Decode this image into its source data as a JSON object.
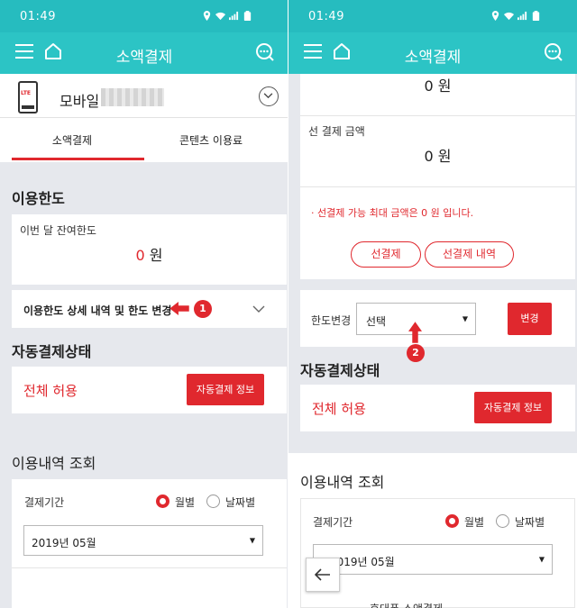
{
  "status": {
    "time": "01:49"
  },
  "app": {
    "title": "소액결제"
  },
  "left": {
    "device_label": "모바일",
    "lte_label": "LTE",
    "tabs": [
      "소액결제",
      "콘텐츠 이용료"
    ],
    "usage_limit": {
      "title": "이용한도",
      "remaining_label": "이번 달 잔여한도",
      "remaining_value": "0",
      "currency": "원",
      "detail_label": "이용한도 상세 내역 및 한도 변경",
      "badge": "1"
    },
    "auto_pay": {
      "title": "자동결제상태",
      "status": "전체 허용",
      "button": "자동결제 정보"
    },
    "history": {
      "title": "이용내역 조회",
      "period_label": "결제기간",
      "radio_monthly": "월별",
      "radio_daily": "날짜별",
      "selected_month": "2019년 05월"
    }
  },
  "right": {
    "top_amount": "0",
    "currency": "원",
    "prepay_label": "선 결제 금액",
    "prepay_amount": "0",
    "notice": "선결제 가능 최대 금액은 0 원 입니다.",
    "notice_bullet": "·",
    "btn_prepay": "선결제",
    "btn_prepay_history": "선결제 내역",
    "limit_change_label": "한도변경",
    "select_placeholder": "선택",
    "change_button": "변경",
    "badge": "2",
    "auto_pay": {
      "title": "자동결제상태",
      "status": "전체 허용",
      "button": "자동결제 정보"
    },
    "history": {
      "title": "이용내역 조회",
      "period_label": "결제기간",
      "radio_monthly": "월별",
      "radio_daily": "날짜별",
      "selected_month": "2019년 05월",
      "partial_text": "휴대폰 소액결제"
    }
  },
  "colors": {
    "teal": "#2cc4c5",
    "red": "#e0282e"
  }
}
